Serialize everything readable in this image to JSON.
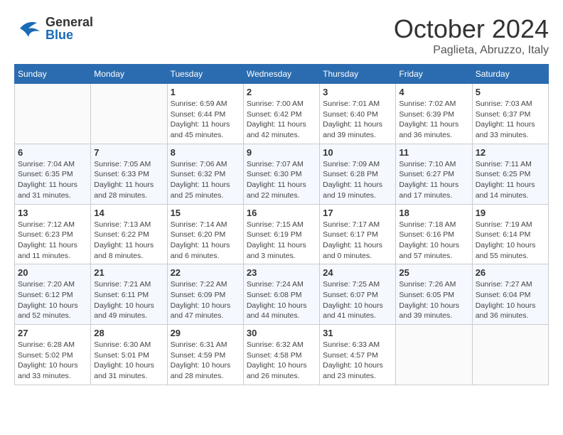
{
  "header": {
    "logo": {
      "line1": "General",
      "line2": "Blue"
    },
    "title": "October 2024",
    "location": "Paglieta, Abruzzo, Italy"
  },
  "weekdays": [
    "Sunday",
    "Monday",
    "Tuesday",
    "Wednesday",
    "Thursday",
    "Friday",
    "Saturday"
  ],
  "weeks": [
    [
      {
        "day": "",
        "detail": ""
      },
      {
        "day": "",
        "detail": ""
      },
      {
        "day": "1",
        "detail": "Sunrise: 6:59 AM\nSunset: 6:44 PM\nDaylight: 11 hours\nand 45 minutes."
      },
      {
        "day": "2",
        "detail": "Sunrise: 7:00 AM\nSunset: 6:42 PM\nDaylight: 11 hours\nand 42 minutes."
      },
      {
        "day": "3",
        "detail": "Sunrise: 7:01 AM\nSunset: 6:40 PM\nDaylight: 11 hours\nand 39 minutes."
      },
      {
        "day": "4",
        "detail": "Sunrise: 7:02 AM\nSunset: 6:39 PM\nDaylight: 11 hours\nand 36 minutes."
      },
      {
        "day": "5",
        "detail": "Sunrise: 7:03 AM\nSunset: 6:37 PM\nDaylight: 11 hours\nand 33 minutes."
      }
    ],
    [
      {
        "day": "6",
        "detail": "Sunrise: 7:04 AM\nSunset: 6:35 PM\nDaylight: 11 hours\nand 31 minutes."
      },
      {
        "day": "7",
        "detail": "Sunrise: 7:05 AM\nSunset: 6:33 PM\nDaylight: 11 hours\nand 28 minutes."
      },
      {
        "day": "8",
        "detail": "Sunrise: 7:06 AM\nSunset: 6:32 PM\nDaylight: 11 hours\nand 25 minutes."
      },
      {
        "day": "9",
        "detail": "Sunrise: 7:07 AM\nSunset: 6:30 PM\nDaylight: 11 hours\nand 22 minutes."
      },
      {
        "day": "10",
        "detail": "Sunrise: 7:09 AM\nSunset: 6:28 PM\nDaylight: 11 hours\nand 19 minutes."
      },
      {
        "day": "11",
        "detail": "Sunrise: 7:10 AM\nSunset: 6:27 PM\nDaylight: 11 hours\nand 17 minutes."
      },
      {
        "day": "12",
        "detail": "Sunrise: 7:11 AM\nSunset: 6:25 PM\nDaylight: 11 hours\nand 14 minutes."
      }
    ],
    [
      {
        "day": "13",
        "detail": "Sunrise: 7:12 AM\nSunset: 6:23 PM\nDaylight: 11 hours\nand 11 minutes."
      },
      {
        "day": "14",
        "detail": "Sunrise: 7:13 AM\nSunset: 6:22 PM\nDaylight: 11 hours\nand 8 minutes."
      },
      {
        "day": "15",
        "detail": "Sunrise: 7:14 AM\nSunset: 6:20 PM\nDaylight: 11 hours\nand 6 minutes."
      },
      {
        "day": "16",
        "detail": "Sunrise: 7:15 AM\nSunset: 6:19 PM\nDaylight: 11 hours\nand 3 minutes."
      },
      {
        "day": "17",
        "detail": "Sunrise: 7:17 AM\nSunset: 6:17 PM\nDaylight: 11 hours\nand 0 minutes."
      },
      {
        "day": "18",
        "detail": "Sunrise: 7:18 AM\nSunset: 6:16 PM\nDaylight: 10 hours\nand 57 minutes."
      },
      {
        "day": "19",
        "detail": "Sunrise: 7:19 AM\nSunset: 6:14 PM\nDaylight: 10 hours\nand 55 minutes."
      }
    ],
    [
      {
        "day": "20",
        "detail": "Sunrise: 7:20 AM\nSunset: 6:12 PM\nDaylight: 10 hours\nand 52 minutes."
      },
      {
        "day": "21",
        "detail": "Sunrise: 7:21 AM\nSunset: 6:11 PM\nDaylight: 10 hours\nand 49 minutes."
      },
      {
        "day": "22",
        "detail": "Sunrise: 7:22 AM\nSunset: 6:09 PM\nDaylight: 10 hours\nand 47 minutes."
      },
      {
        "day": "23",
        "detail": "Sunrise: 7:24 AM\nSunset: 6:08 PM\nDaylight: 10 hours\nand 44 minutes."
      },
      {
        "day": "24",
        "detail": "Sunrise: 7:25 AM\nSunset: 6:07 PM\nDaylight: 10 hours\nand 41 minutes."
      },
      {
        "day": "25",
        "detail": "Sunrise: 7:26 AM\nSunset: 6:05 PM\nDaylight: 10 hours\nand 39 minutes."
      },
      {
        "day": "26",
        "detail": "Sunrise: 7:27 AM\nSunset: 6:04 PM\nDaylight: 10 hours\nand 36 minutes."
      }
    ],
    [
      {
        "day": "27",
        "detail": "Sunrise: 6:28 AM\nSunset: 5:02 PM\nDaylight: 10 hours\nand 33 minutes."
      },
      {
        "day": "28",
        "detail": "Sunrise: 6:30 AM\nSunset: 5:01 PM\nDaylight: 10 hours\nand 31 minutes."
      },
      {
        "day": "29",
        "detail": "Sunrise: 6:31 AM\nSunset: 4:59 PM\nDaylight: 10 hours\nand 28 minutes."
      },
      {
        "day": "30",
        "detail": "Sunrise: 6:32 AM\nSunset: 4:58 PM\nDaylight: 10 hours\nand 26 minutes."
      },
      {
        "day": "31",
        "detail": "Sunrise: 6:33 AM\nSunset: 4:57 PM\nDaylight: 10 hours\nand 23 minutes."
      },
      {
        "day": "",
        "detail": ""
      },
      {
        "day": "",
        "detail": ""
      }
    ]
  ]
}
